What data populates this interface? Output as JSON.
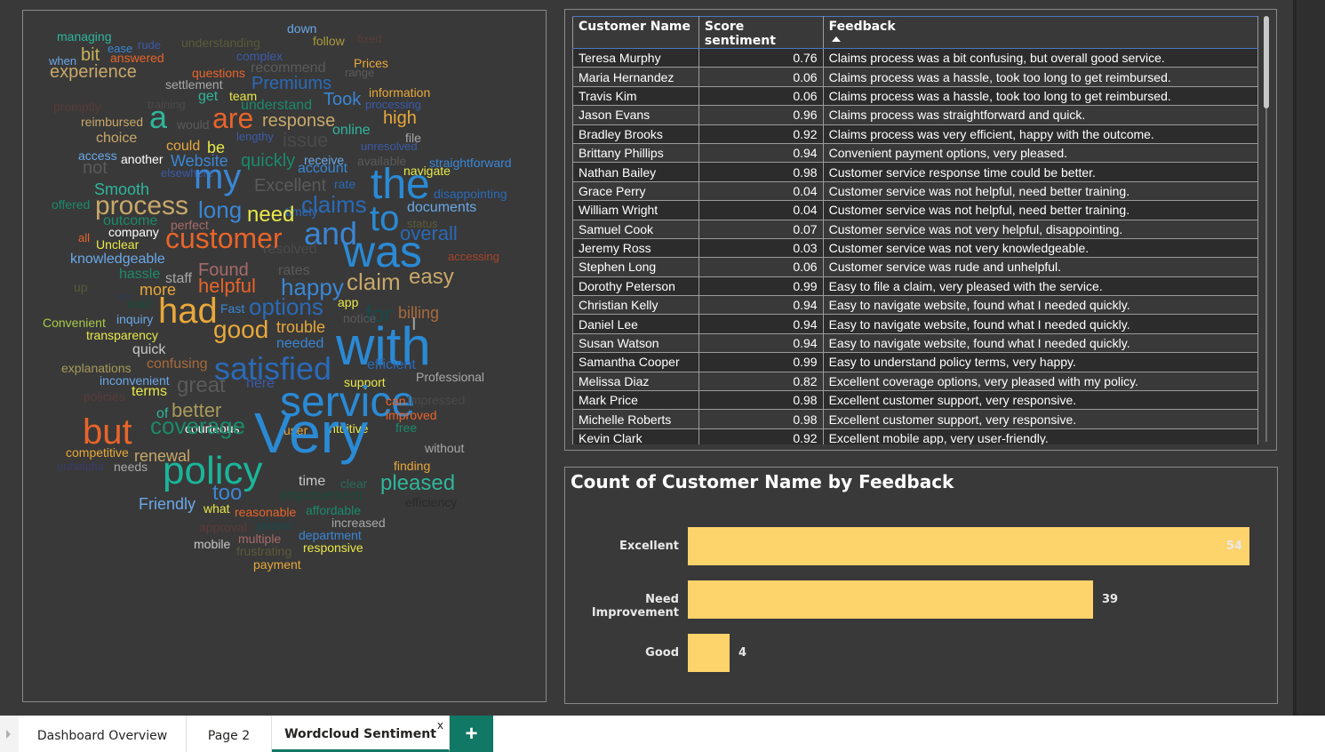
{
  "wordcloud": {
    "words": [
      {
        "text": "managing",
        "color": "#2fb59a",
        "size": 14
      },
      {
        "text": "ease",
        "color": "#3a86d4",
        "size": 13
      },
      {
        "text": "rude",
        "color": "#3a5aa8",
        "size": 13
      },
      {
        "text": "understanding",
        "color": "#5a5a3a",
        "size": 14
      },
      {
        "text": "down",
        "color": "#6aa8e8",
        "size": 14
      },
      {
        "text": "follow",
        "color": "#a89a3a",
        "size": 14
      },
      {
        "text": "fixed",
        "color": "#5a3a3a",
        "size": 13
      },
      {
        "text": "when",
        "color": "#6aa8e8",
        "size": 13
      },
      {
        "text": "bit",
        "color": "#c8b45a",
        "size": 20
      },
      {
        "text": "answered",
        "color": "#e8642a",
        "size": 14
      },
      {
        "text": "complex",
        "color": "#3a5aa8",
        "size": 14
      },
      {
        "text": "Prices",
        "color": "#e8a83a",
        "size": 14
      },
      {
        "text": "experience",
        "color": "#c8a86a",
        "size": 20
      },
      {
        "text": "questions",
        "color": "#e8642a",
        "size": 14
      },
      {
        "text": "recommend",
        "color": "#5a5a5a",
        "size": 16
      },
      {
        "text": "range",
        "color": "#5a5a5a",
        "size": 13
      },
      {
        "text": "settlement",
        "color": "#a8a8a8",
        "size": 14
      },
      {
        "text": "Premiums",
        "color": "#2a6ab8",
        "size": 20
      },
      {
        "text": "get",
        "color": "#2fb59a",
        "size": 16
      },
      {
        "text": "team",
        "color": "#e8e84a",
        "size": 14
      },
      {
        "text": "Took",
        "color": "#3a86d4",
        "size": 20
      },
      {
        "text": "information",
        "color": "#e8a83a",
        "size": 14
      },
      {
        "text": "promptly",
        "color": "#5a3a3a",
        "size": 14
      },
      {
        "text": "training",
        "color": "#4a4a4a",
        "size": 13
      },
      {
        "text": "understand",
        "color": "#1a8a6a",
        "size": 16
      },
      {
        "text": "processing",
        "color": "#3a5aa8",
        "size": 13
      },
      {
        "text": "reimbursed",
        "color": "#c8a86a",
        "size": 14
      },
      {
        "text": "a",
        "color": "#2fb59a",
        "size": 36
      },
      {
        "text": "would",
        "color": "#5a5a5a",
        "size": 14
      },
      {
        "text": "are",
        "color": "#e8642a",
        "size": 32
      },
      {
        "text": "response",
        "color": "#c8a86a",
        "size": 20
      },
      {
        "text": "high",
        "color": "#e8a83a",
        "size": 20
      },
      {
        "text": "choice",
        "color": "#c8a86a",
        "size": 16
      },
      {
        "text": "lengthy",
        "color": "#3a5aa8",
        "size": 13
      },
      {
        "text": "issue",
        "color": "#4a4a4a",
        "size": 22
      },
      {
        "text": "online",
        "color": "#2fb59a",
        "size": 16
      },
      {
        "text": "file",
        "color": "#a8a8a8",
        "size": 14
      },
      {
        "text": "could",
        "color": "#e8a83a",
        "size": 16
      },
      {
        "text": "be",
        "color": "#e8e84a",
        "size": 18
      },
      {
        "text": "unresolved",
        "color": "#3a5aa8",
        "size": 13
      },
      {
        "text": "access",
        "color": "#6aa8e8",
        "size": 14
      },
      {
        "text": "another",
        "color": "#ffffff",
        "size": 14
      },
      {
        "text": "Website",
        "color": "#3a86d4",
        "size": 18
      },
      {
        "text": "quickly",
        "color": "#1a8a6a",
        "size": 20
      },
      {
        "text": "receive",
        "color": "#6aa8e8",
        "size": 14
      },
      {
        "text": "available",
        "color": "#5a5a5a",
        "size": 14
      },
      {
        "text": "straightforward",
        "color": "#3a86d4",
        "size": 14
      },
      {
        "text": "not",
        "color": "#5a5a5a",
        "size": 20
      },
      {
        "text": "elsewhere",
        "color": "#3a5aa8",
        "size": 13
      },
      {
        "text": "my",
        "color": "#3a86d4",
        "size": 40
      },
      {
        "text": "account",
        "color": "#3a86d4",
        "size": 16
      },
      {
        "text": "navigate",
        "color": "#e8e84a",
        "size": 14
      },
      {
        "text": "Smooth",
        "color": "#2fb59a",
        "size": 18
      },
      {
        "text": "Excellent",
        "color": "#5a5a5a",
        "size": 20
      },
      {
        "text": "rate",
        "color": "#2a6ab8",
        "size": 14
      },
      {
        "text": "the",
        "color": "#2a8ad4",
        "size": 48
      },
      {
        "text": "disappointing",
        "color": "#2a6ab8",
        "size": 14
      },
      {
        "text": "offered",
        "color": "#1a8a6a",
        "size": 14
      },
      {
        "text": "process",
        "color": "#c8a86a",
        "size": 30
      },
      {
        "text": "long",
        "color": "#3a86d4",
        "size": 26
      },
      {
        "text": "timely",
        "color": "#2a6ab8",
        "size": 14
      },
      {
        "text": "need",
        "color": "#e8e84a",
        "size": 24
      },
      {
        "text": "claims",
        "color": "#2a6ab8",
        "size": 26
      },
      {
        "text": "to",
        "color": "#2a8ad4",
        "size": 40
      },
      {
        "text": "documents",
        "color": "#6aa8e8",
        "size": 16
      },
      {
        "text": "outcome",
        "color": "#1a8a6a",
        "size": 16
      },
      {
        "text": "status",
        "color": "#5a5a3a",
        "size": 13
      },
      {
        "text": "company",
        "color": "#ffffff",
        "size": 14
      },
      {
        "text": "perfect",
        "color": "#a86a6a",
        "size": 14
      },
      {
        "text": "and",
        "color": "#3a86d4",
        "size": 36
      },
      {
        "text": "overall",
        "color": "#2a6ab8",
        "size": 22
      },
      {
        "text": "all",
        "color": "#e8642a",
        "size": 13
      },
      {
        "text": "Unclear",
        "color": "#e8e84a",
        "size": 14
      },
      {
        "text": "customer",
        "color": "#e8642a",
        "size": 32
      },
      {
        "text": "resolved",
        "color": "#4a4a4a",
        "size": 16
      },
      {
        "text": "was",
        "color": "#2a8ad4",
        "size": 50
      },
      {
        "text": "accessing",
        "color": "#a8442a",
        "size": 13
      },
      {
        "text": "knowledgeable",
        "color": "#6aa8e8",
        "size": 16
      },
      {
        "text": "hassle",
        "color": "#1a8a6a",
        "size": 16
      },
      {
        "text": "staff",
        "color": "#a8a8a8",
        "size": 16
      },
      {
        "text": "Found",
        "color": "#a86a6a",
        "size": 20
      },
      {
        "text": "rates",
        "color": "#5a5a5a",
        "size": 16
      },
      {
        "text": "claim",
        "color": "#c8a86a",
        "size": 26
      },
      {
        "text": "easy",
        "color": "#c8a86a",
        "size": 24
      },
      {
        "text": "up",
        "color": "#5a5a3a",
        "size": 14
      },
      {
        "text": "on",
        "color": "#2a3a5a",
        "size": 13
      },
      {
        "text": "more",
        "color": "#e8a83a",
        "size": 18
      },
      {
        "text": "helpful",
        "color": "#e8642a",
        "size": 22
      },
      {
        "text": "happy",
        "color": "#3a86d4",
        "size": 26
      },
      {
        "text": "minor",
        "color": "#3a3a3a",
        "size": 13
      },
      {
        "text": "wait",
        "color": "#1a4a3a",
        "size": 16
      },
      {
        "text": "had",
        "color": "#e8a83a",
        "size": 40
      },
      {
        "text": "Fast",
        "color": "#3a86d4",
        "size": 14
      },
      {
        "text": "options",
        "color": "#2a6ab8",
        "size": 26
      },
      {
        "text": "app",
        "color": "#e8e84a",
        "size": 14
      },
      {
        "text": "for",
        "color": "#1a4a4a",
        "size": 26
      },
      {
        "text": "billing",
        "color": "#a86a3a",
        "size": 18
      },
      {
        "text": "Convenient",
        "color": "#a8c84a",
        "size": 14
      },
      {
        "text": "inquiry",
        "color": "#6aa8e8",
        "size": 14
      },
      {
        "text": "notice",
        "color": "#5a5a5a",
        "size": 14
      },
      {
        "text": "I",
        "color": "#a8a8a8",
        "size": 20
      },
      {
        "text": "good",
        "color": "#e8a83a",
        "size": 28
      },
      {
        "text": "trouble",
        "color": "#e8a83a",
        "size": 18
      },
      {
        "text": "with",
        "color": "#2a8ad4",
        "size": 60
      },
      {
        "text": "transparency",
        "color": "#e8e84a",
        "size": 14
      },
      {
        "text": "needed",
        "color": "#3a86d4",
        "size": 16
      },
      {
        "text": "others",
        "color": "#3a3a3a",
        "size": 14
      },
      {
        "text": "quick",
        "color": "#c8c8c8",
        "size": 16
      },
      {
        "text": "details",
        "color": "#3a3a3a",
        "size": 14
      },
      {
        "text": "explanations",
        "color": "#a89a5a",
        "size": 14
      },
      {
        "text": "confusing",
        "color": "#a86a3a",
        "size": 16
      },
      {
        "text": "satisfied",
        "color": "#2a6ab8",
        "size": 36
      },
      {
        "text": "efficient",
        "color": "#2a6ab8",
        "size": 16
      },
      {
        "text": "inconvenient",
        "color": "#6aa8e8",
        "size": 14
      },
      {
        "text": "Professional",
        "color": "#a8a8a8",
        "size": 14
      },
      {
        "text": "support",
        "color": "#e8e84a",
        "size": 14
      },
      {
        "text": "policies",
        "color": "#5a3a3a",
        "size": 14
      },
      {
        "text": "terms",
        "color": "#e8e84a",
        "size": 16
      },
      {
        "text": "great",
        "color": "#5a5a5a",
        "size": 24
      },
      {
        "text": "here",
        "color": "#3a5aa8",
        "size": 16
      },
      {
        "text": "service",
        "color": "#2a8ad4",
        "size": 48
      },
      {
        "text": "can",
        "color": "#e8642a",
        "size": 14
      },
      {
        "text": "Impressed",
        "color": "#4a4a4a",
        "size": 14
      },
      {
        "text": "of",
        "color": "#2fb59a",
        "size": 16
      },
      {
        "text": "better",
        "color": "#a89a5a",
        "size": 22
      },
      {
        "text": "improved",
        "color": "#e8642a",
        "size": 14
      },
      {
        "text": "courteous",
        "color": "#ffffff",
        "size": 14
      },
      {
        "text": "user",
        "color": "#e8a83a",
        "size": 14
      },
      {
        "text": "intuitive",
        "color": "#e8e84a",
        "size": 14
      },
      {
        "text": "free",
        "color": "#1a8a6a",
        "size": 14
      },
      {
        "text": "but",
        "color": "#e8642a",
        "size": 40
      },
      {
        "text": "coverage",
        "color": "#1a8a6a",
        "size": 26
      },
      {
        "text": "Very",
        "color": "#2a8ad4",
        "size": 64
      },
      {
        "text": "competitive",
        "color": "#e8a83a",
        "size": 14
      },
      {
        "text": "renewal",
        "color": "#c8a86a",
        "size": 18
      },
      {
        "text": "without",
        "color": "#a8a8a8",
        "size": 14
      },
      {
        "text": "unhelpful",
        "color": "#3a3a6a",
        "size": 13
      },
      {
        "text": "needs",
        "color": "#a8a8a8",
        "size": 14
      },
      {
        "text": "policy",
        "color": "#1ab59a",
        "size": 44
      },
      {
        "text": "finding",
        "color": "#e8a83a",
        "size": 14
      },
      {
        "text": "time",
        "color": "#c8c8c8",
        "size": 16
      },
      {
        "text": "clear",
        "color": "#2a6a5a",
        "size": 14
      },
      {
        "text": "pleased",
        "color": "#2fb59a",
        "size": 24
      },
      {
        "text": "too",
        "color": "#3a86d4",
        "size": 24
      },
      {
        "text": "improvement",
        "color": "#1a4a3a",
        "size": 16
      },
      {
        "text": "efficiency",
        "color": "#2a2a2a",
        "size": 14
      },
      {
        "text": "Friendly",
        "color": "#6aa8e8",
        "size": 18
      },
      {
        "text": "what",
        "color": "#e8e84a",
        "size": 14
      },
      {
        "text": "reasonable",
        "color": "#e8642a",
        "size": 14
      },
      {
        "text": "affordable",
        "color": "#1a8a6a",
        "size": 14
      },
      {
        "text": "increased",
        "color": "#a8a8a8",
        "size": 14
      },
      {
        "text": "approval",
        "color": "#5a3a3a",
        "size": 14
      },
      {
        "text": "phone",
        "color": "#1a4a4a",
        "size": 14
      },
      {
        "text": "department",
        "color": "#3a86d4",
        "size": 14
      },
      {
        "text": "mobile",
        "color": "#c8c8c8",
        "size": 14
      },
      {
        "text": "multiple",
        "color": "#a86a6a",
        "size": 14
      },
      {
        "text": "responsive",
        "color": "#e8e84a",
        "size": 14
      },
      {
        "text": "frustrating",
        "color": "#5a5a3a",
        "size": 14
      },
      {
        "text": "payment",
        "color": "#e8a83a",
        "size": 14
      }
    ]
  },
  "table": {
    "headers": [
      "Customer Name",
      "Score sentiment",
      "Feedback"
    ],
    "sorted_column": "Feedback",
    "rows": [
      [
        "Teresa Murphy",
        "0.76",
        "Claims process was a bit confusing, but overall good service."
      ],
      [
        "Maria Hernandez",
        "0.06",
        "Claims process was a hassle, took too long to get reimbursed."
      ],
      [
        "Travis Kim",
        "0.06",
        "Claims process was a hassle, took too long to get reimbursed."
      ],
      [
        "Jason Evans",
        "0.96",
        "Claims process was straightforward and quick."
      ],
      [
        "Bradley Brooks",
        "0.92",
        "Claims process was very efficient, happy with the outcome."
      ],
      [
        "Brittany Phillips",
        "0.94",
        "Convenient payment options, very pleased."
      ],
      [
        "Nathan Bailey",
        "0.98",
        "Customer service response time could be better."
      ],
      [
        "Grace Perry",
        "0.04",
        "Customer service was not helpful, need better training."
      ],
      [
        "William Wright",
        "0.04",
        "Customer service was not helpful, need better training."
      ],
      [
        "Samuel Cook",
        "0.07",
        "Customer service was not very helpful, disappointing."
      ],
      [
        "Jeremy Ross",
        "0.03",
        "Customer service was not very knowledgeable."
      ],
      [
        "Stephen Long",
        "0.06",
        "Customer service was rude and unhelpful."
      ],
      [
        "Dorothy Peterson",
        "0.99",
        "Easy to file a claim, very pleased with the service."
      ],
      [
        "Christian Kelly",
        "0.94",
        "Easy to navigate website, found what I needed quickly."
      ],
      [
        "Daniel Lee",
        "0.94",
        "Easy to navigate website, found what I needed quickly."
      ],
      [
        "Susan Watson",
        "0.94",
        "Easy to navigate website, found what I needed quickly."
      ],
      [
        "Samantha Cooper",
        "0.99",
        "Easy to understand policy terms, very happy."
      ],
      [
        "Melissa Diaz",
        "0.82",
        "Excellent coverage options, very pleased with my policy."
      ],
      [
        "Mark Price",
        "0.98",
        "Excellent customer support, very responsive."
      ],
      [
        "Michelle Roberts",
        "0.98",
        "Excellent customer support, very responsive."
      ],
      [
        "Kevin Clark",
        "0.92",
        "Excellent mobile app, very user-friendly."
      ]
    ]
  },
  "chart_data": {
    "type": "bar",
    "orientation": "horizontal",
    "title": "Count of Customer Name by Feedback",
    "categories": [
      "Excellent",
      "Need Improvement",
      "Good"
    ],
    "values": [
      54,
      39,
      4
    ],
    "bar_color": "#fdd36b",
    "xlim": [
      0,
      54
    ]
  },
  "tabs": {
    "items": [
      {
        "label": "Dashboard Overview"
      },
      {
        "label": "Page 2"
      },
      {
        "label": "Wordcloud Sentiment"
      }
    ],
    "active": "Wordcloud Sentiment",
    "close_glyph": "x",
    "add_glyph": "+"
  }
}
